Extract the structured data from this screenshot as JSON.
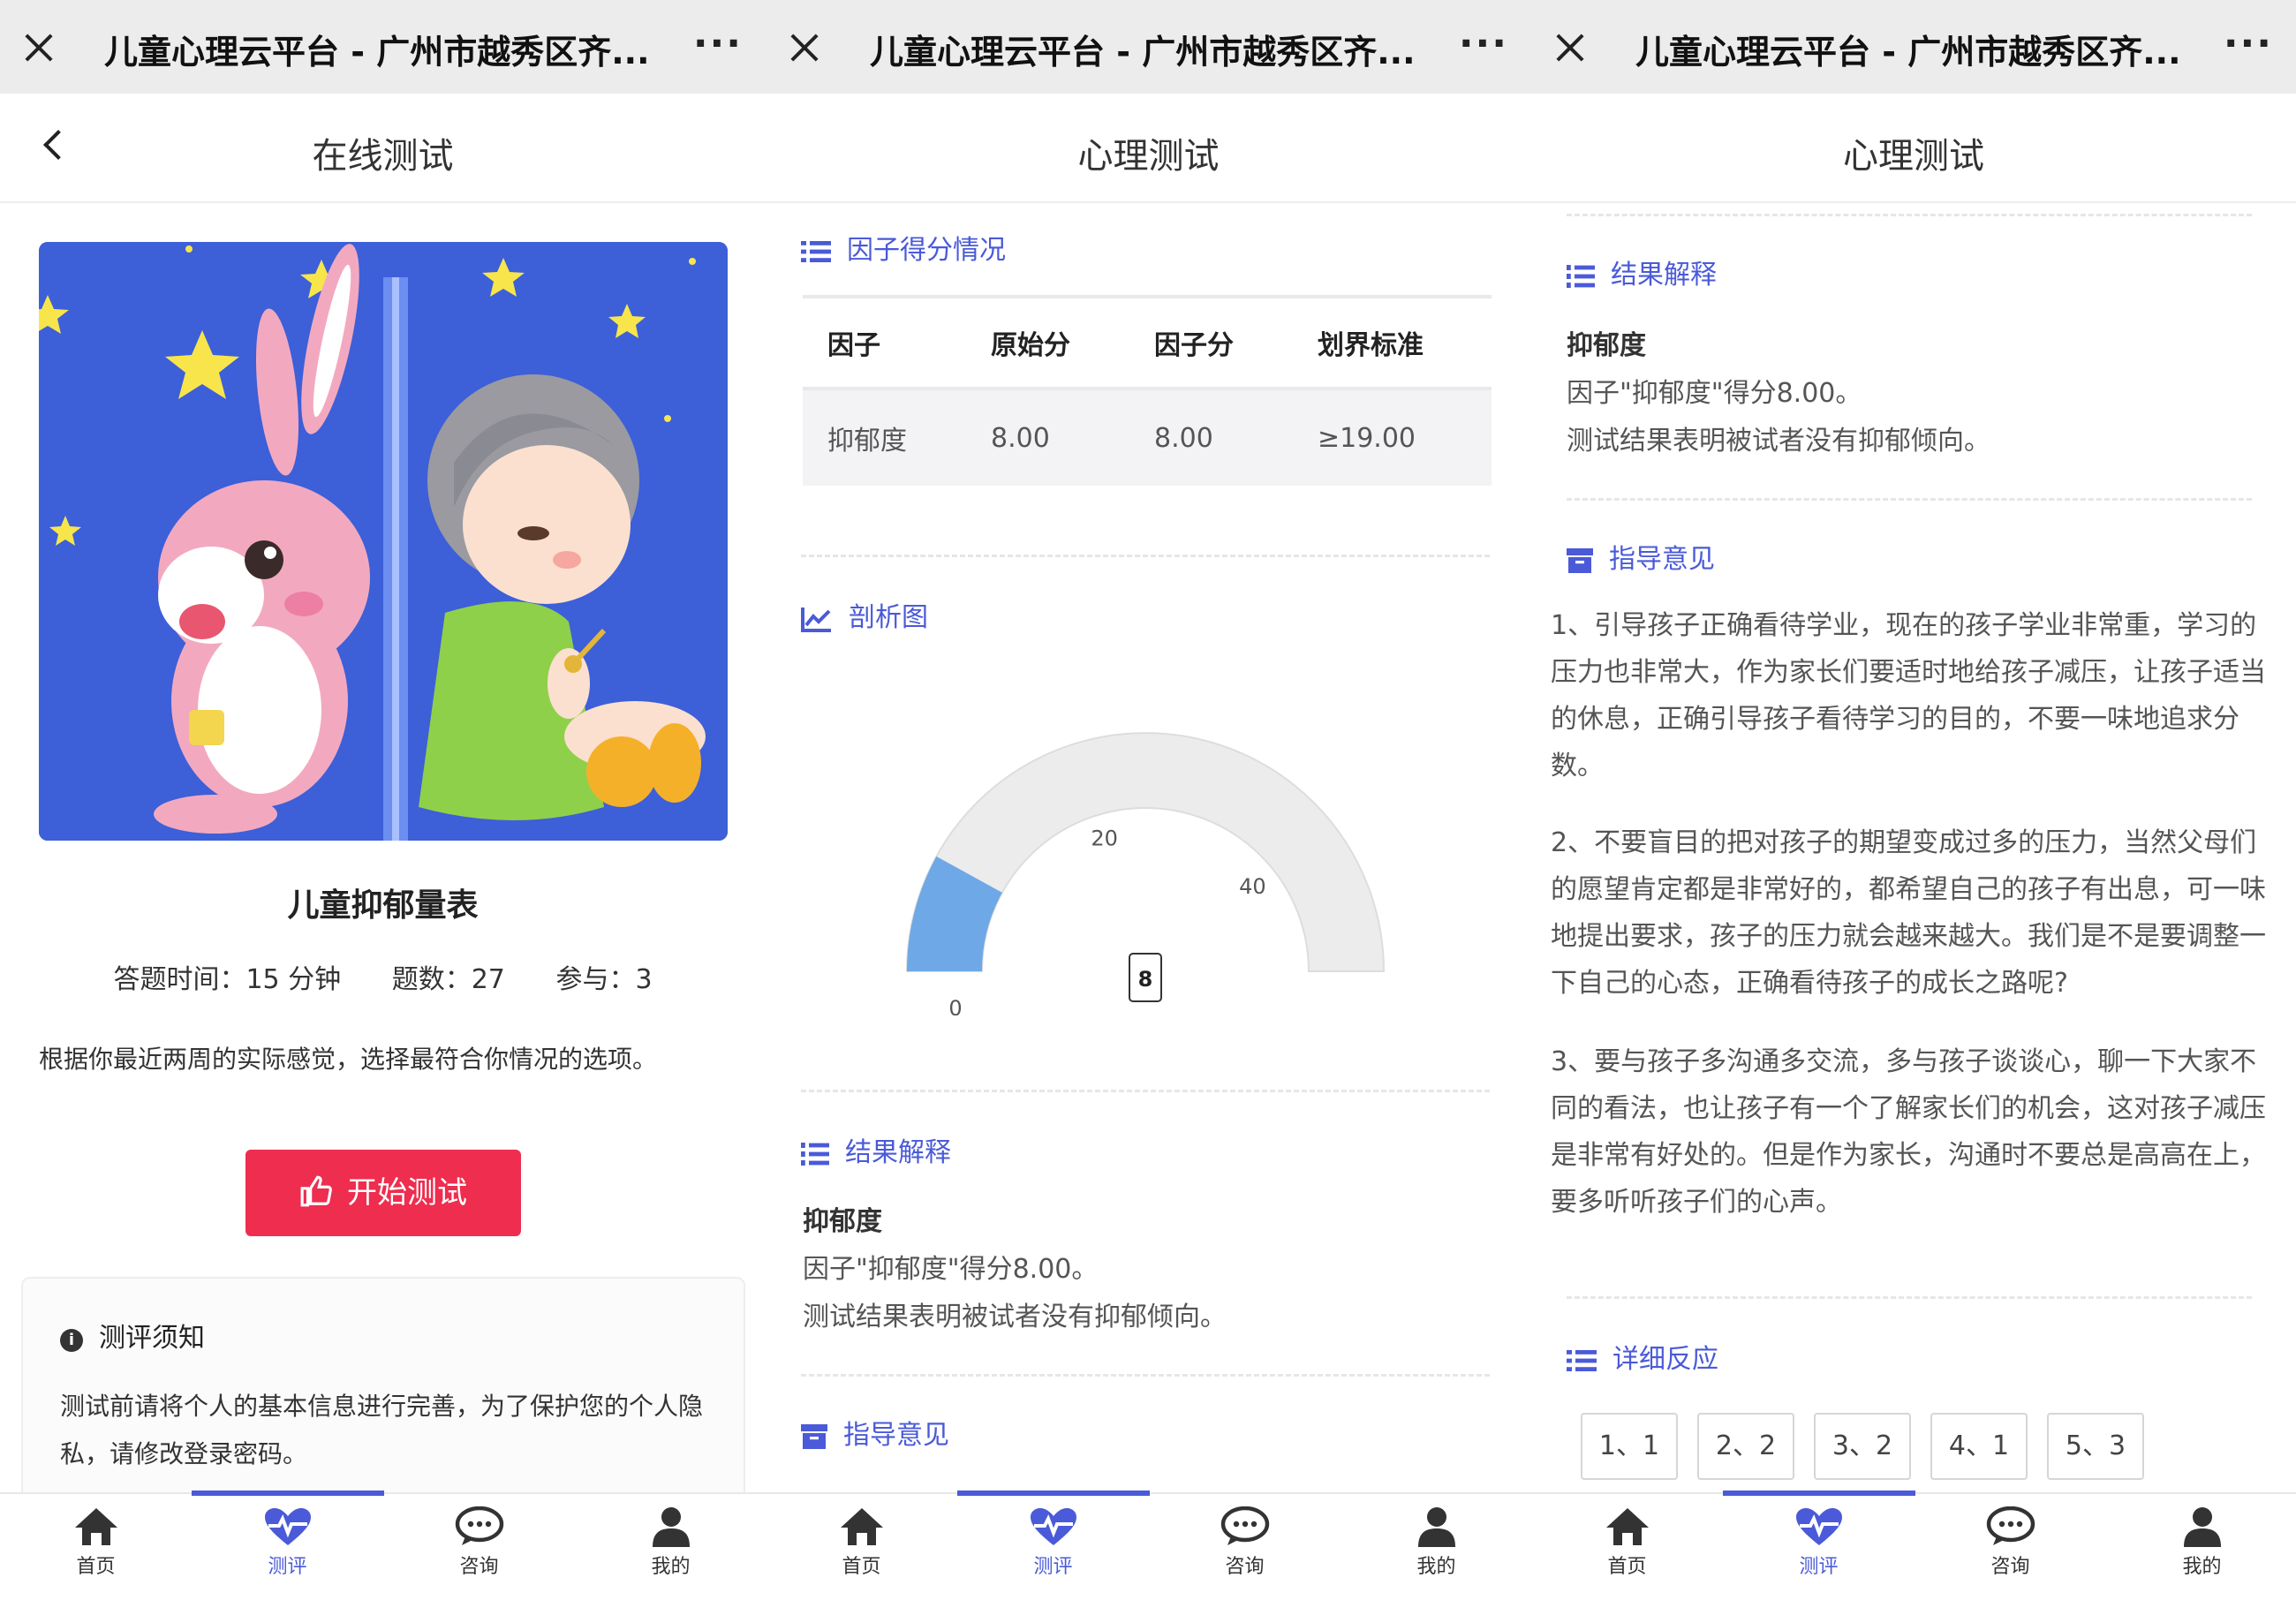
{
  "window_title": "儿童心理云平台 - 广州市越秀区齐...",
  "more_label": "···",
  "screen1": {
    "page_title": "在线测试",
    "scale_name": "儿童抑郁量表",
    "answer_time": "答题时间：15 分钟",
    "question_count": "题数：27",
    "participants": "参与：3",
    "intro": "根据你最近两周的实际感觉，选择最符合你情况的选项。",
    "start_button": "开始测试",
    "notice_title": "测评须知",
    "notice_body": "测试前请将个人的基本信息进行完善，为了保护您的个人隐私，请修改登录密码。"
  },
  "screen2": {
    "page_title": "心理测试",
    "factor_section": "因子得分情况",
    "table": {
      "headers": [
        "因子",
        "原始分",
        "因子分",
        "划界标准"
      ],
      "rows": [
        [
          "抑郁度",
          "8.00",
          "8.00",
          "≥19.00"
        ]
      ]
    },
    "chart_section": "剖析图",
    "result_section": "结果解释",
    "result_factor": "抑郁度",
    "result_score": "因子\"抑郁度\"得分8.00。",
    "result_conclusion": "测试结果表明被试者没有抑郁倾向。",
    "guidance_section": "指导意见"
  },
  "chart_data": {
    "type": "gauge",
    "min": 0,
    "max": 50,
    "value": 8,
    "value_label": "8",
    "tick_labels": [
      "0",
      "20",
      "40"
    ],
    "fill_color": "#6fa8e6",
    "track_color": "#ececec"
  },
  "screen3": {
    "page_title": "心理测试",
    "result_section": "结果解释",
    "result_factor": "抑郁度",
    "result_score": "因子\"抑郁度\"得分8.00。",
    "result_conclusion": "测试结果表明被试者没有抑郁倾向。",
    "guidance_section": "指导意见",
    "advice": [
      "1、引导孩子正确看待学业，现在的孩子学业非常重，学习的压力也非常大，作为家长们要适时地给孩子减压，让孩子适当的休息，正确引导孩子看待学习的目的，不要一味地追求分数。",
      "2、不要盲目的把对孩子的期望变成过多的压力，当然父母们的愿望肯定都是非常好的，都希望自己的孩子有出息，可一味地提出要求，孩子的压力就会越来越大。我们是不是要调整一下自己的心态，正确看待孩子的成长之路呢?",
      "3、要与孩子多沟通多交流，多与孩子谈谈心，聊一下大家不同的看法，也让孩子有一个了解家长们的机会，这对孩子减压是非常有好处的。但是作为家长，沟通时不要总是高高在上，要多听听孩子们的心声。"
    ],
    "detail_section": "详细反应",
    "responses": [
      "1、1",
      "2、2",
      "3、2",
      "4、1",
      "5、3"
    ]
  },
  "tabs": [
    "首页",
    "测评",
    "咨询",
    "我的"
  ],
  "colors": {
    "accent": "#4a5ad8",
    "start_button": "#ee2d4f",
    "gauge_fill": "#6fa8e6"
  }
}
